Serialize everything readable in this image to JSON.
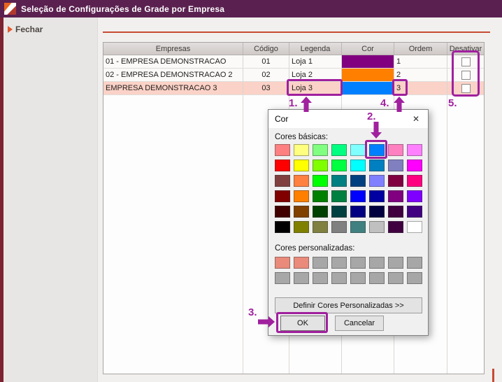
{
  "theme": {
    "titlebar-bg": "#5A2150",
    "left-strip": "#7C2230",
    "accent-line": "#C74B32",
    "annotation": "#A0209E",
    "row-highlight": "#FBD2C7",
    "sidebar-arrow": "#E4572E"
  },
  "window": {
    "title": "Seleção de Configurações de Grade por Empresa"
  },
  "sidebar": {
    "close_label": "Fechar"
  },
  "table": {
    "headers": [
      "Empresas",
      "Código",
      "Legenda",
      "Cor",
      "Ordem",
      "Desativar"
    ],
    "rows": [
      {
        "empresa": "01 - EMPRESA DEMONSTRACAO",
        "codigo": "01",
        "legenda": "Loja 1",
        "cor": "#800080",
        "ordem": "1",
        "desativar": false
      },
      {
        "empresa": "02 - EMPRESA DEMONSTRACAO 2",
        "codigo": "02",
        "legenda": "Loja 2",
        "cor": "#FF8000",
        "ordem": "2",
        "desativar": false
      },
      {
        "empresa": "EMPRESA DEMONSTRACAO 3",
        "codigo": "03",
        "legenda": "Loja 3",
        "cor": "#0080FF",
        "ordem": "3",
        "desativar": false
      }
    ]
  },
  "color_dialog": {
    "title": "Cor",
    "close_glyph": "✕",
    "basic_label": "Cores básicas:",
    "custom_label": "Cores personalizadas:",
    "define_custom_button": "Definir Cores Personalizadas >>",
    "ok_button": "OK",
    "cancel_button": "Cancelar",
    "selected_index": 5,
    "selected_color": "#0080FF",
    "basic_colors": [
      "#FF8080",
      "#FFFF80",
      "#80FF80",
      "#00FF80",
      "#80FFFF",
      "#0080FF",
      "#FF80C0",
      "#FF80FF",
      "#FF0000",
      "#FFFF00",
      "#80FF00",
      "#00FF40",
      "#00FFFF",
      "#0080C0",
      "#8080C0",
      "#FF00FF",
      "#804040",
      "#FF8040",
      "#00FF00",
      "#008080",
      "#004080",
      "#8080FF",
      "#800040",
      "#FF0080",
      "#800000",
      "#FF8000",
      "#008000",
      "#008040",
      "#0000FF",
      "#0000A0",
      "#800080",
      "#8000FF",
      "#400000",
      "#804000",
      "#004000",
      "#004040",
      "#000080",
      "#000040",
      "#400040",
      "#400080",
      "#000000",
      "#808000",
      "#808040",
      "#808080",
      "#408080",
      "#C0C0C0",
      "#400040",
      "#FFFFFF"
    ],
    "custom_colors": [
      "#E98A7B",
      "#E98A7B",
      "#A7A7A7",
      "#A7A7A7",
      "#A7A7A7",
      "#A7A7A7",
      "#A7A7A7",
      "#A7A7A7",
      "#A7A7A7",
      "#A7A7A7",
      "#A7A7A7",
      "#A7A7A7",
      "#A7A7A7",
      "#A7A7A7",
      "#A7A7A7",
      "#A7A7A7"
    ]
  },
  "annotations": {
    "steps": [
      {
        "label": "1."
      },
      {
        "label": "2."
      },
      {
        "label": "3."
      },
      {
        "label": "4."
      },
      {
        "label": "5."
      }
    ]
  }
}
